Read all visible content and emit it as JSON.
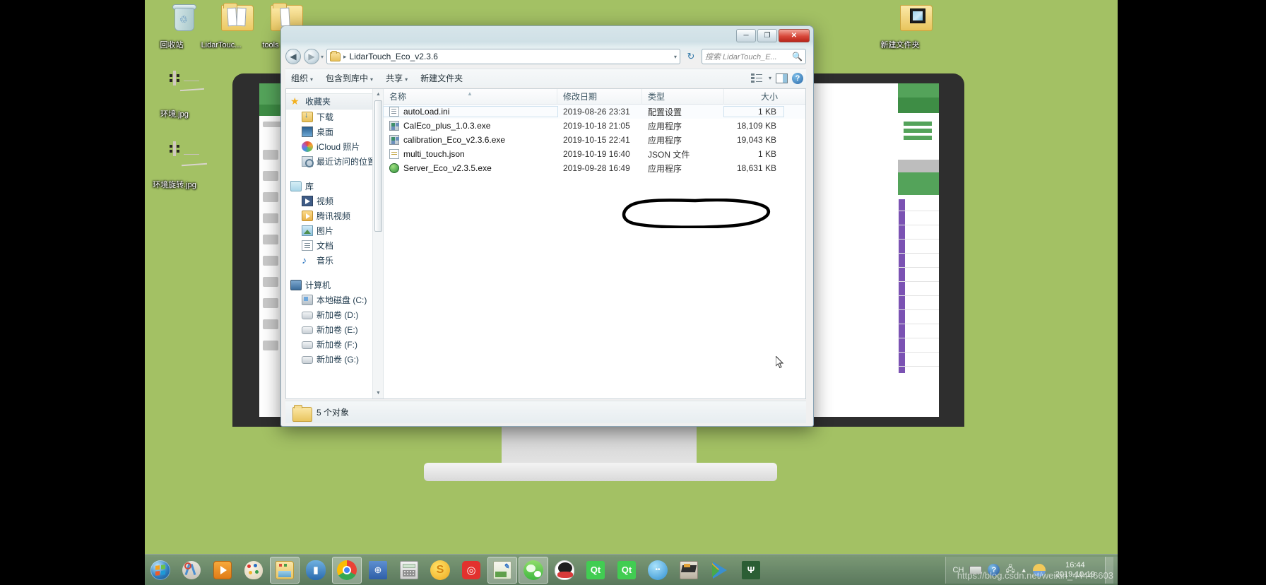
{
  "desktop": {
    "icons": [
      {
        "name": "回收站",
        "icon": "recycle-bin-icon"
      },
      {
        "name": "LidarTouc...",
        "icon": "folder-icon"
      },
      {
        "name": "tools",
        "icon": "folder-icon"
      },
      {
        "name": "环境.jpg",
        "icon": "image-file-icon"
      },
      {
        "name": "环境旋转.jpg",
        "icon": "image-file-icon"
      },
      {
        "name": "新建文件夹",
        "icon": "folder-icon"
      }
    ]
  },
  "explorer": {
    "title": "LidarTouch_Eco_v2.3.6",
    "window_buttons": {
      "minimize": "─",
      "maximize": "❐",
      "close": "✕"
    },
    "nav": {
      "back": "◀",
      "forward": "▶",
      "recent_caret": "▾",
      "refresh": "↻",
      "path_caret": "▾",
      "separator": "▸"
    },
    "search": {
      "placeholder": "搜索 LidarTouch_E...",
      "icon": "search-icon"
    },
    "toolbar": {
      "organize": "组织",
      "include_in_library": "包含到库中",
      "share": "共享",
      "new_folder": "新建文件夹",
      "views_icon": "list-view-icon",
      "preview_pane_icon": "preview-pane-icon",
      "help_icon": "help-icon",
      "caret": "▾"
    },
    "nav_pane": {
      "favorites": {
        "label": "收藏夹",
        "icon": "star-icon"
      },
      "favorite_items": [
        {
          "label": "下载",
          "icon": "downloads-icon"
        },
        {
          "label": "桌面",
          "icon": "desktop-icon"
        },
        {
          "label": "iCloud 照片",
          "icon": "icloud-photos-icon"
        },
        {
          "label": "最近访问的位置",
          "icon": "recent-places-icon"
        }
      ],
      "libraries": {
        "label": "库",
        "icon": "library-icon"
      },
      "library_items": [
        {
          "label": "视频",
          "icon": "video-icon"
        },
        {
          "label": "腾讯视频",
          "icon": "tencent-video-icon"
        },
        {
          "label": "图片",
          "icon": "pictures-icon"
        },
        {
          "label": "文档",
          "icon": "documents-icon"
        },
        {
          "label": "音乐",
          "icon": "music-icon"
        }
      ],
      "computer": {
        "label": "计算机",
        "icon": "computer-icon"
      },
      "drives": [
        {
          "label": "本地磁盘 (C:)",
          "icon": "system-drive-icon"
        },
        {
          "label": "新加卷 (D:)",
          "icon": "drive-icon"
        },
        {
          "label": "新加卷 (E:)",
          "icon": "drive-icon"
        },
        {
          "label": "新加卷 (F:)",
          "icon": "drive-icon"
        },
        {
          "label": "新加卷 (G:)",
          "icon": "drive-icon"
        }
      ]
    },
    "columns": {
      "name": "名称",
      "date": "修改日期",
      "type": "类型",
      "size": "大小"
    },
    "files": [
      {
        "name": "autoLoad.ini",
        "date": "2019-08-26 23:31",
        "type": "配置设置",
        "size": "1 KB",
        "icon": "ini-file-icon",
        "selected": true,
        "circled": false
      },
      {
        "name": "CalEco_plus_1.0.3.exe",
        "date": "2019-10-18 21:05",
        "type": "应用程序",
        "size": "18,109 KB",
        "icon": "exe-file-icon",
        "selected": false,
        "circled": false
      },
      {
        "name": "calibration_Eco_v2.3.6.exe",
        "date": "2019-10-15 22:41",
        "type": "应用程序",
        "size": "19,043 KB",
        "icon": "exe-file-icon",
        "selected": false,
        "circled": true
      },
      {
        "name": "multi_touch.json",
        "date": "2019-10-19 16:40",
        "type": "JSON 文件",
        "size": "1 KB",
        "icon": "json-file-icon",
        "selected": false,
        "circled": false
      },
      {
        "name": "Server_Eco_v2.3.5.exe",
        "date": "2019-09-28 16:49",
        "type": "应用程序",
        "size": "18,631 KB",
        "icon": "server-exe-icon",
        "selected": false,
        "circled": false
      }
    ],
    "status": {
      "count": "5 个对象",
      "icon": "folder-icon"
    }
  },
  "taskbar": {
    "start_icon": "windows-start-icon",
    "items": [
      {
        "icon": "snipping-tool-icon",
        "active": false
      },
      {
        "icon": "media-player-icon",
        "active": false
      },
      {
        "icon": "paint-icon",
        "active": false
      },
      {
        "icon": "explorer-icon",
        "active": true
      },
      {
        "icon": "pdf-reader-icon",
        "active": false
      },
      {
        "icon": "chrome-icon",
        "active": true
      },
      {
        "icon": "dictionary-icon",
        "active": false
      },
      {
        "icon": "calculator-icon",
        "active": false
      },
      {
        "icon": "sogou-icon",
        "active": false
      },
      {
        "icon": "netease-music-icon",
        "active": false
      },
      {
        "icon": "notepad-plus-icon",
        "active": true
      },
      {
        "icon": "wechat-icon",
        "active": true
      },
      {
        "icon": "qq-icon",
        "active": false
      },
      {
        "icon": "qt-creator-icon",
        "active": false
      },
      {
        "icon": "qt-designer-icon",
        "active": false
      },
      {
        "icon": "aliwangwang-icon",
        "active": false
      },
      {
        "icon": "cad-icon",
        "active": false
      },
      {
        "icon": "potplayer-icon",
        "active": false
      },
      {
        "icon": "vmware-icon",
        "active": false
      }
    ],
    "tray": {
      "input_method": "CH",
      "keyboard_icon": "keyboard-icon",
      "help_icon": "help-icon",
      "network_icon": "network-icon",
      "show_hidden_icon": "show-hidden-icons-icon",
      "weather_icon": "weather-icon"
    },
    "clock": {
      "time": "16:44",
      "date": "2019-10-19"
    }
  },
  "watermark": "https://blog.csdn.net/weixin_44446603"
}
